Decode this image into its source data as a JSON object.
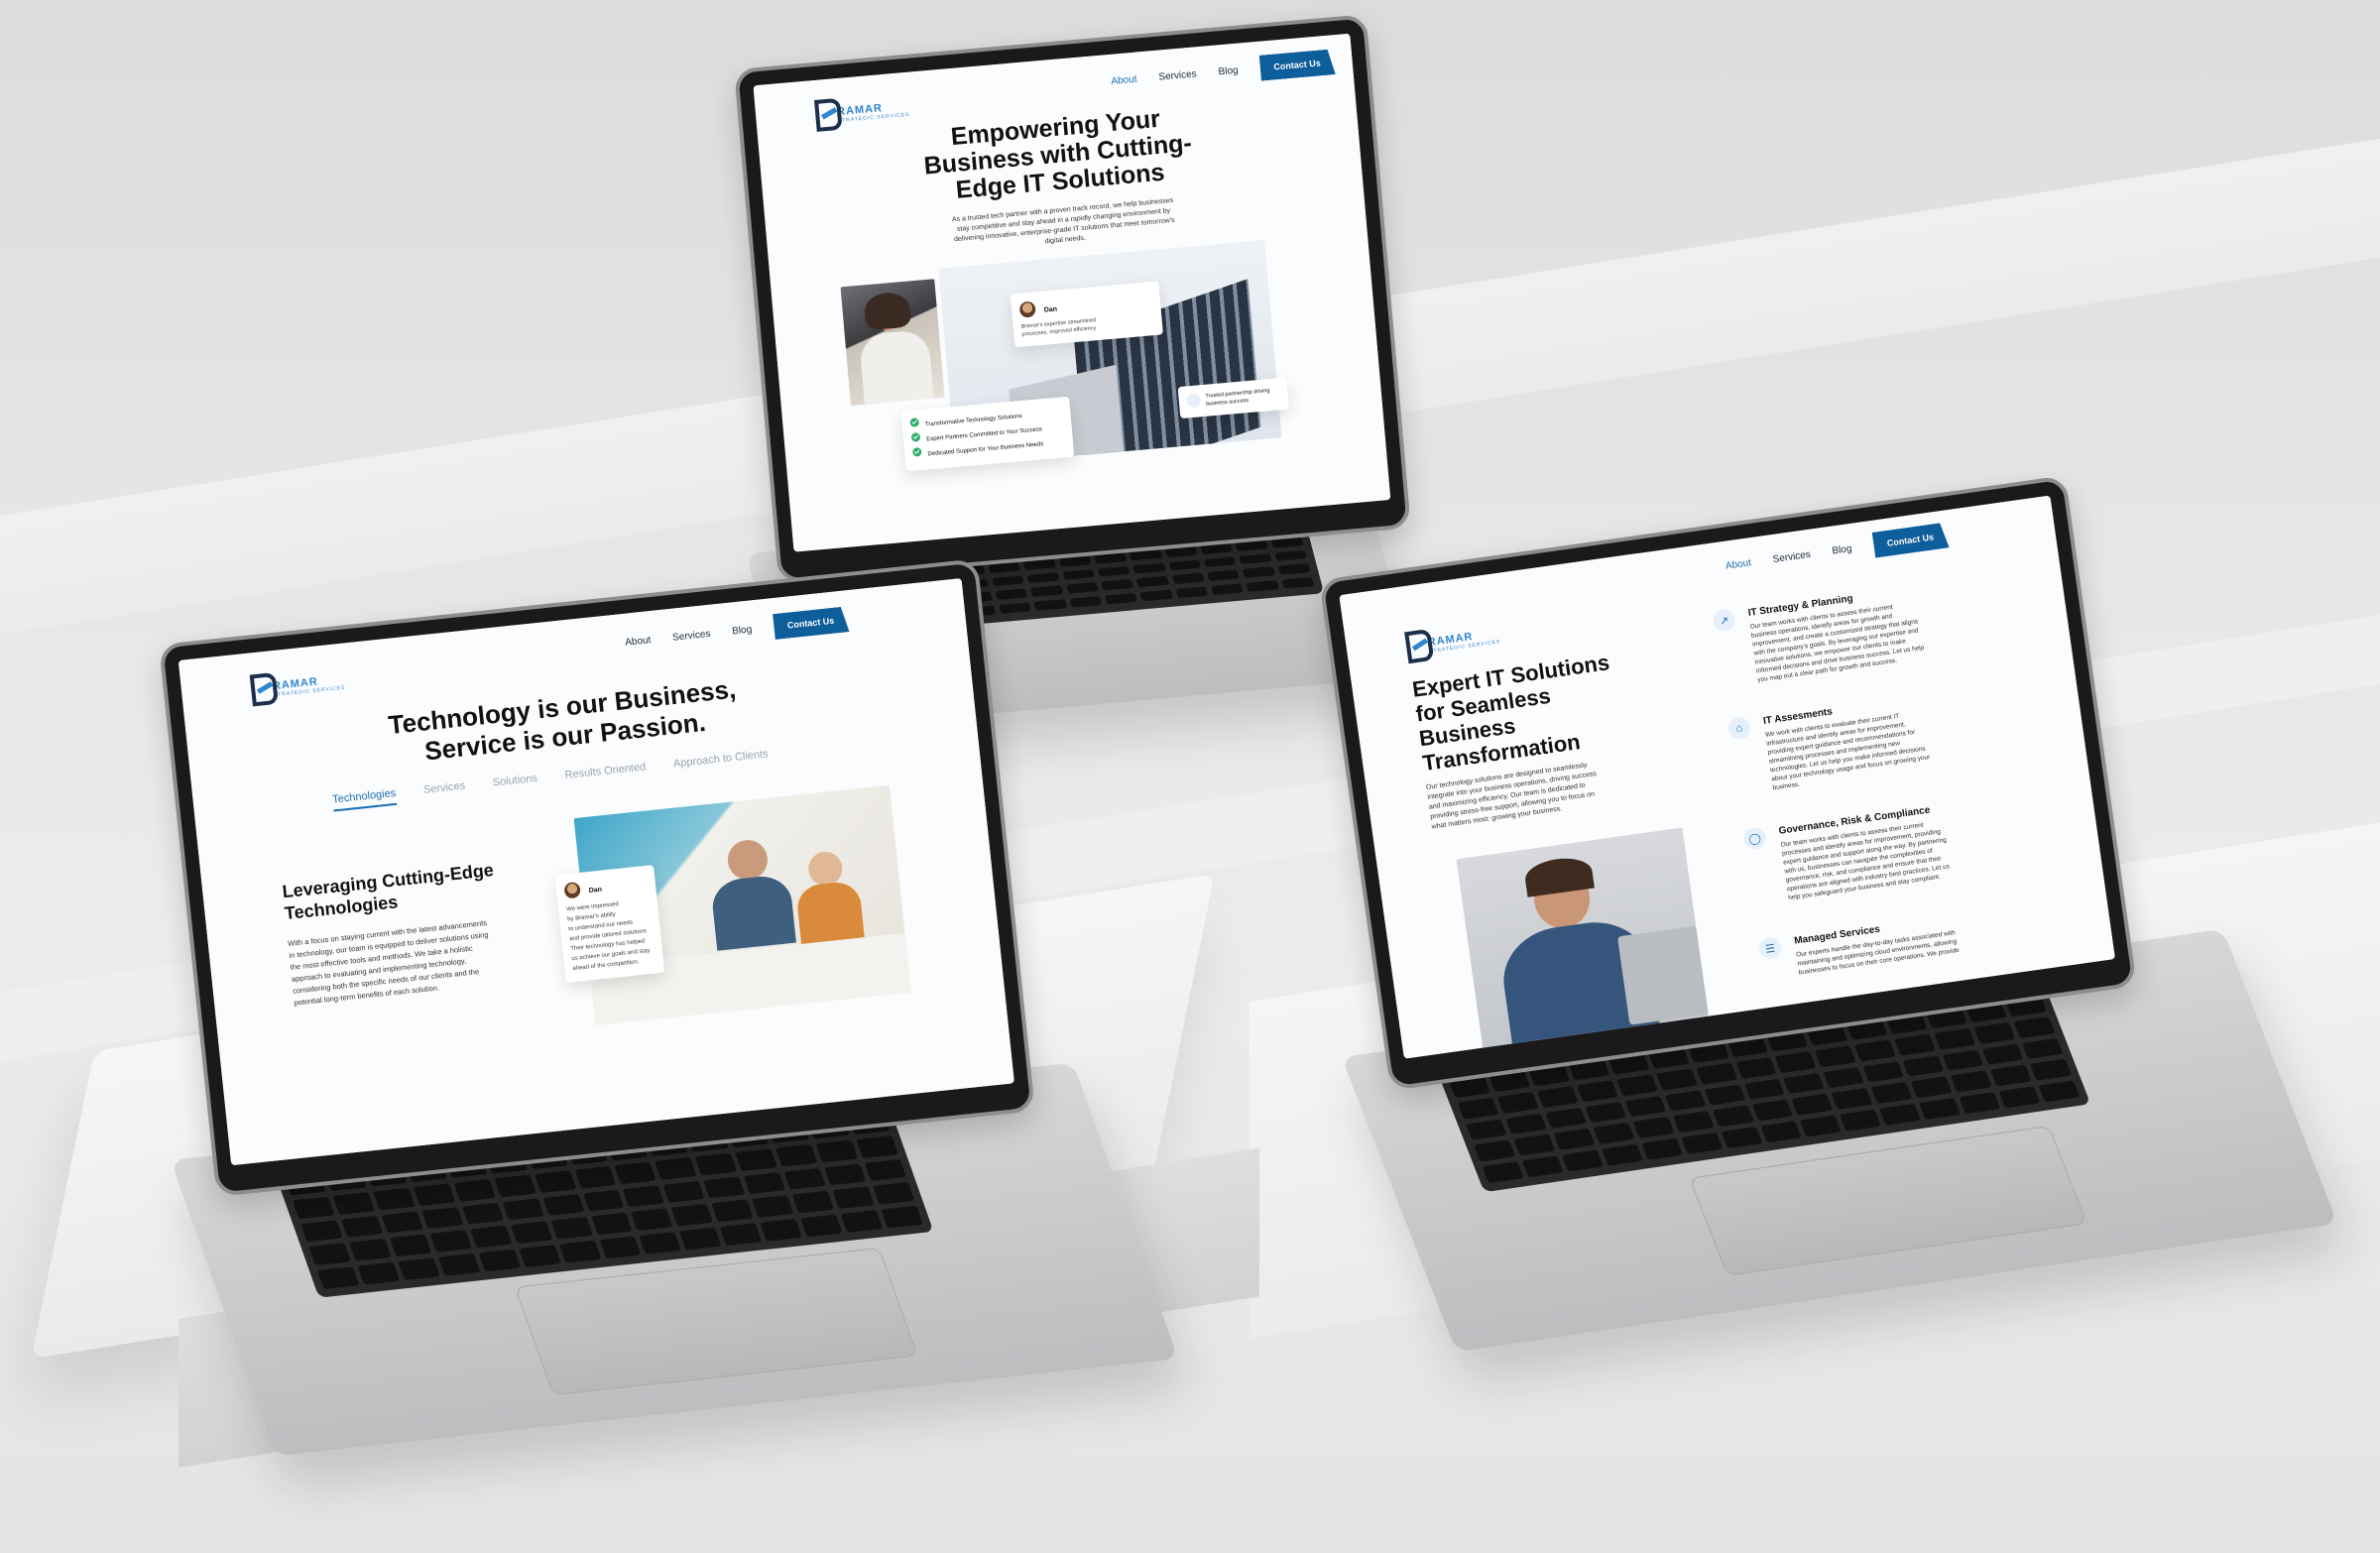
{
  "brand": {
    "name": "RAMAR",
    "tagline": "STRATEGIC SERVICES"
  },
  "nav": {
    "about": "About",
    "services": "Services",
    "blog": "Blog",
    "contact": "Contact Us"
  },
  "screen_top": {
    "title_lines": [
      "Empowering Your",
      "Business with Cutting-",
      "Edge IT Solutions"
    ],
    "body_lines": [
      "As a trusted tech partner with a proven track record, we help businesses",
      "stay competitive and stay ahead in a rapidly changing environment by",
      "delivering innovative, enterprise-grade IT solutions that meet tomorrow's",
      "digital needs."
    ],
    "testimonial": {
      "name": "Dan",
      "lines": [
        "Bramar's expertise streamlined",
        "processes, improved efficiency"
      ]
    },
    "checklist": [
      "Transformative Technology Solutions",
      "Expert Partners Committed to Your Success",
      "Dedicated Support for Your Business Needs"
    ],
    "trust_badge": {
      "lines": [
        "Trusted partnership driving",
        "business success"
      ]
    }
  },
  "screen_left": {
    "title_lines": [
      "Technology is our Business,",
      "Service is our Passion."
    ],
    "tabs": [
      "Technologies",
      "Services",
      "Solutions",
      "Results Oriented",
      "Approach to Clients"
    ],
    "active_tab": "Technologies",
    "section_title_lines": [
      "Leveraging Cutting-Edge",
      "Technologies"
    ],
    "section_body_lines": [
      "With a focus on staying current with the latest advancements",
      "in technology, our team is equipped to deliver solutions using",
      "the most effective tools and methods. We take a holistic",
      "approach to evaluating and implementing technology,",
      "considering both the specific needs of our clients and the",
      "potential long-term benefits of each solution."
    ],
    "testimonial": {
      "name": "Dan",
      "lines": [
        "We were impressed",
        "by Bramar's ability",
        "to understand our needs",
        "and provide tailored solutions",
        "Their technology has helped",
        "us achieve our goals and stay",
        "ahead of the competition."
      ]
    }
  },
  "screen_right": {
    "title_lines": [
      "Expert IT Solutions",
      "for Seamless",
      "Business",
      "Transformation"
    ],
    "body_lines": [
      "Our technology solutions are designed to seamlessly",
      "integrate into your business operations, driving success",
      "and maximizing efficiency. Our team is dedicated to",
      "providing stress-free support, allowing you to focus on",
      "what matters most: growing your business."
    ],
    "services": [
      {
        "icon": "trend-icon",
        "title": "IT Strategy & Planning",
        "lines": [
          "Our team works with clients to assess their current",
          "business operations, identify areas for growth and",
          "improvement, and create a customized strategy that aligns",
          "with the company's goals. By leveraging our expertise and",
          "innovative solutions, we empower our clients to make",
          "informed decisions and drive business success. Let us help",
          "you map out a clear path for growth and success."
        ]
      },
      {
        "icon": "home-icon",
        "title": "IT Assesments",
        "lines": [
          "We work with clients to evaluate their current IT",
          "infrastructure and identify areas for improvement,",
          "providing expert guidance and recommendations for",
          "streamlining processes and implementing new",
          "technologies. Let us help you make informed decisions",
          "about your technology usage and focus on growing your",
          "business."
        ]
      },
      {
        "icon": "shield-icon",
        "title": "Governance, Risk & Compliance",
        "lines": [
          "Our team works with clients to assess their current",
          "processes and identify areas for improvement, providing",
          "expert guidance and support along the way. By partnering",
          "with us, businesses can navigate the complexities of",
          "governance, risk, and compliance and ensure that their",
          "operations are aligned with industry best practices. Let us",
          "help you safeguard your business and stay compliant."
        ]
      },
      {
        "icon": "database-icon",
        "title": "Managed Services",
        "lines": [
          "Our experts handle the day-to-day tasks associated with",
          "maintaining and optimizing cloud environments, allowing",
          "businesses to focus on their core operations. We provide"
        ]
      }
    ]
  }
}
